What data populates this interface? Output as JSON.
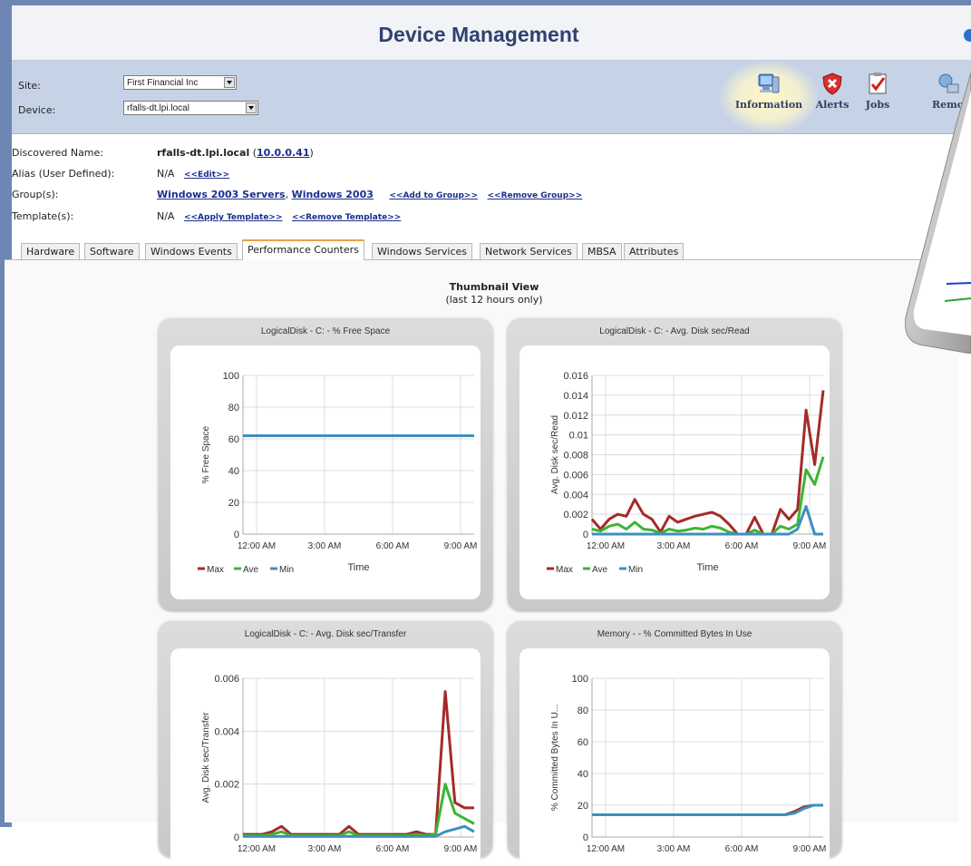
{
  "app": {
    "title": "Device Management"
  },
  "selectors": {
    "site_label": "Site:",
    "site_value": "First Financial Inc",
    "device_label": "Device:",
    "device_value": "rfalls-dt.lpi.local"
  },
  "nav": {
    "information": "Information",
    "alerts": "Alerts",
    "jobs": "Jobs",
    "remote": "Remo"
  },
  "details": {
    "discovered_label": "Discovered Name:",
    "discovered_value": "rfalls-dt.lpi.local",
    "discovered_ip": "10.0.0.41",
    "alias_label": "Alias (User Defined):",
    "alias_value": "N/A",
    "alias_edit": "<<Edit>>",
    "group_label": "Group(s):",
    "group_1": "Windows 2003 Servers",
    "group_2": "Windows 2003",
    "add_group": "<<Add to Group>>",
    "remove_group": "<<Remove Group>>",
    "template_label": "Template(s):",
    "template_value": "N/A",
    "apply_template": "<<Apply Template>>",
    "remove_template": "<<Remove Template>>"
  },
  "tabs": [
    "Hardware",
    "Software",
    "Windows Events",
    "Performance Counters",
    "Windows Services",
    "Network Services",
    "MBSA",
    "Attributes"
  ],
  "thumbnail": {
    "title": "Thumbnail View",
    "subtitle": "(last 12 hours only)"
  },
  "colors": {
    "max": "#a52a2a",
    "ave": "#3cb531",
    "min": "#3d8fbf"
  },
  "chart_data": [
    {
      "type": "line",
      "title": "LogicalDisk - C: - % Free Space",
      "xlabel": "Time",
      "ylabel": "% Free Space",
      "ylim": [
        0,
        100
      ],
      "yticks": [
        "0",
        "20",
        "40",
        "60",
        "80",
        "100"
      ],
      "xticks": [
        "12:00 AM",
        "3:00 AM",
        "6:00 AM",
        "9:00 AM"
      ],
      "legend": [
        "Max",
        "Ave",
        "Min"
      ],
      "grid": true,
      "series": [
        {
          "name": "Max",
          "values": [
            62,
            62,
            62,
            62,
            62,
            62,
            62,
            62,
            62,
            62,
            62,
            62,
            62,
            62,
            62,
            62,
            62,
            62,
            62,
            62,
            62,
            62,
            62,
            62,
            62,
            62,
            62,
            62,
            62,
            62,
            62,
            62,
            62,
            62,
            62,
            62,
            62,
            62,
            62,
            62
          ]
        },
        {
          "name": "Ave",
          "values": [
            62,
            62,
            62,
            62,
            62,
            62,
            62,
            62,
            62,
            62,
            62,
            62,
            62,
            62,
            62,
            62,
            62,
            62,
            62,
            62,
            62,
            62,
            62,
            62,
            62,
            62,
            62,
            62,
            62,
            62,
            62,
            62,
            62,
            62,
            62,
            62,
            62,
            62,
            62,
            62
          ]
        },
        {
          "name": "Min",
          "values": [
            62,
            62,
            62,
            62,
            62,
            62,
            62,
            62,
            62,
            62,
            62,
            62,
            62,
            62,
            62,
            62,
            62,
            62,
            62,
            62,
            62,
            62,
            62,
            62,
            62,
            62,
            62,
            62,
            62,
            62,
            62,
            62,
            62,
            62,
            62,
            62,
            62,
            62,
            62,
            62
          ]
        }
      ]
    },
    {
      "type": "line",
      "title": "LogicalDisk - C: - Avg. Disk sec/Read",
      "xlabel": "Time",
      "ylabel": "Avg. Disk sec/Read",
      "ylim": [
        0,
        0.016
      ],
      "yticks": [
        "0",
        "0.002",
        "0.004",
        "0.006",
        "0.008",
        "0.01",
        "0.012",
        "0.014",
        "0.016"
      ],
      "xticks": [
        "12:00 AM",
        "3:00 AM",
        "6:00 AM",
        "9:00 AM"
      ],
      "legend": [
        "Max",
        "Ave",
        "Min"
      ],
      "grid": true,
      "series": [
        {
          "name": "Max",
          "values": [
            0.0015,
            0.0005,
            0.0015,
            0.002,
            0.0018,
            0.0035,
            0.002,
            0.0015,
            0.0002,
            0.0018,
            0.0012,
            0.0015,
            0.0018,
            0.002,
            0.0022,
            0.0018,
            0.001,
            0,
            0,
            0.0017,
            0,
            0,
            0.0025,
            0.0015,
            0.0025,
            0.0125,
            0.007,
            0.0145
          ]
        },
        {
          "name": "Ave",
          "values": [
            0.0005,
            0.0003,
            0.0008,
            0.001,
            0.0005,
            0.0012,
            0.0005,
            0.0004,
            0.0001,
            0.0005,
            0.0003,
            0.0004,
            0.0006,
            0.0005,
            0.0008,
            0.0006,
            0.0002,
            0,
            0,
            0.0004,
            0,
            0,
            0.0008,
            0.0005,
            0.001,
            0.0065,
            0.005,
            0.0078
          ]
        },
        {
          "name": "Min",
          "values": [
            0,
            0,
            0,
            0,
            0,
            0,
            0,
            0,
            0,
            0,
            0,
            0,
            0,
            0,
            0,
            0,
            0,
            0,
            0,
            0,
            0,
            0,
            0,
            0,
            0.0005,
            0.0028,
            0,
            0
          ]
        }
      ]
    },
    {
      "type": "line",
      "title": "LogicalDisk - C: - Avg. Disk sec/Transfer",
      "xlabel": "Time",
      "ylabel": "Avg. Disk sec/Transfer",
      "ylim": [
        0,
        0.006
      ],
      "yticks": [
        "0",
        "0.002",
        "0.004",
        "0.006"
      ],
      "xticks": [
        "12:00 AM",
        "3:00 AM",
        "6:00 AM",
        "9:00 AM"
      ],
      "legend": [
        "Max",
        "Ave",
        "Min"
      ],
      "grid": true,
      "series": [
        {
          "name": "Max",
          "values": [
            0.0001,
            0.0001,
            0.0001,
            0.0002,
            0.0004,
            0.0001,
            0.0001,
            0.0001,
            0.0001,
            0.0001,
            0.0001,
            0.0004,
            0.0001,
            0.0001,
            0.0001,
            0.0001,
            0.0001,
            0.0001,
            0.0002,
            0.0001,
            0.0001,
            0.0055,
            0.0013,
            0.0011,
            0.0011
          ]
        },
        {
          "name": "Ave",
          "values": [
            5e-05,
            5e-05,
            5e-05,
            0.0001,
            0.0002,
            5e-05,
            5e-05,
            5e-05,
            5e-05,
            5e-05,
            5e-05,
            0.0002,
            5e-05,
            5e-05,
            5e-05,
            5e-05,
            5e-05,
            5e-05,
            0.0001,
            5e-05,
            0.0001,
            0.002,
            0.0009,
            0.0007,
            0.0005
          ]
        },
        {
          "name": "Min",
          "values": [
            2e-05,
            2e-05,
            2e-05,
            2e-05,
            2e-05,
            2e-05,
            2e-05,
            2e-05,
            2e-05,
            2e-05,
            2e-05,
            2e-05,
            2e-05,
            2e-05,
            2e-05,
            2e-05,
            2e-05,
            2e-05,
            2e-05,
            2e-05,
            2e-05,
            0.0002,
            0.0003,
            0.0004,
            0.0002
          ]
        }
      ]
    },
    {
      "type": "line",
      "title": "Memory - - % Committed Bytes In Use",
      "xlabel": "Time",
      "ylabel": "% Committed Bytes In U...",
      "ylim": [
        0,
        100
      ],
      "yticks": [
        "0",
        "20",
        "40",
        "60",
        "80",
        "100"
      ],
      "xticks": [
        "12:00 AM",
        "3:00 AM",
        "6:00 AM",
        "9:00 AM"
      ],
      "legend": [
        "Max",
        "Ave",
        "Min"
      ],
      "grid": true,
      "series": [
        {
          "name": "Max",
          "values": [
            14,
            14,
            14,
            14,
            14,
            14,
            14,
            14,
            14,
            14,
            14,
            14,
            14,
            14,
            14,
            14,
            14,
            14,
            14,
            14,
            14,
            16,
            19,
            20,
            20
          ]
        },
        {
          "name": "Ave",
          "values": [
            14,
            14,
            14,
            14,
            14,
            14,
            14,
            14,
            14,
            14,
            14,
            14,
            14,
            14,
            14,
            14,
            14,
            14,
            14,
            14,
            14,
            15,
            18,
            20,
            20
          ]
        },
        {
          "name": "Min",
          "values": [
            14,
            14,
            14,
            14,
            14,
            14,
            14,
            14,
            14,
            14,
            14,
            14,
            14,
            14,
            14,
            14,
            14,
            14,
            14,
            14,
            14,
            15,
            18,
            20,
            20
          ]
        }
      ]
    }
  ]
}
